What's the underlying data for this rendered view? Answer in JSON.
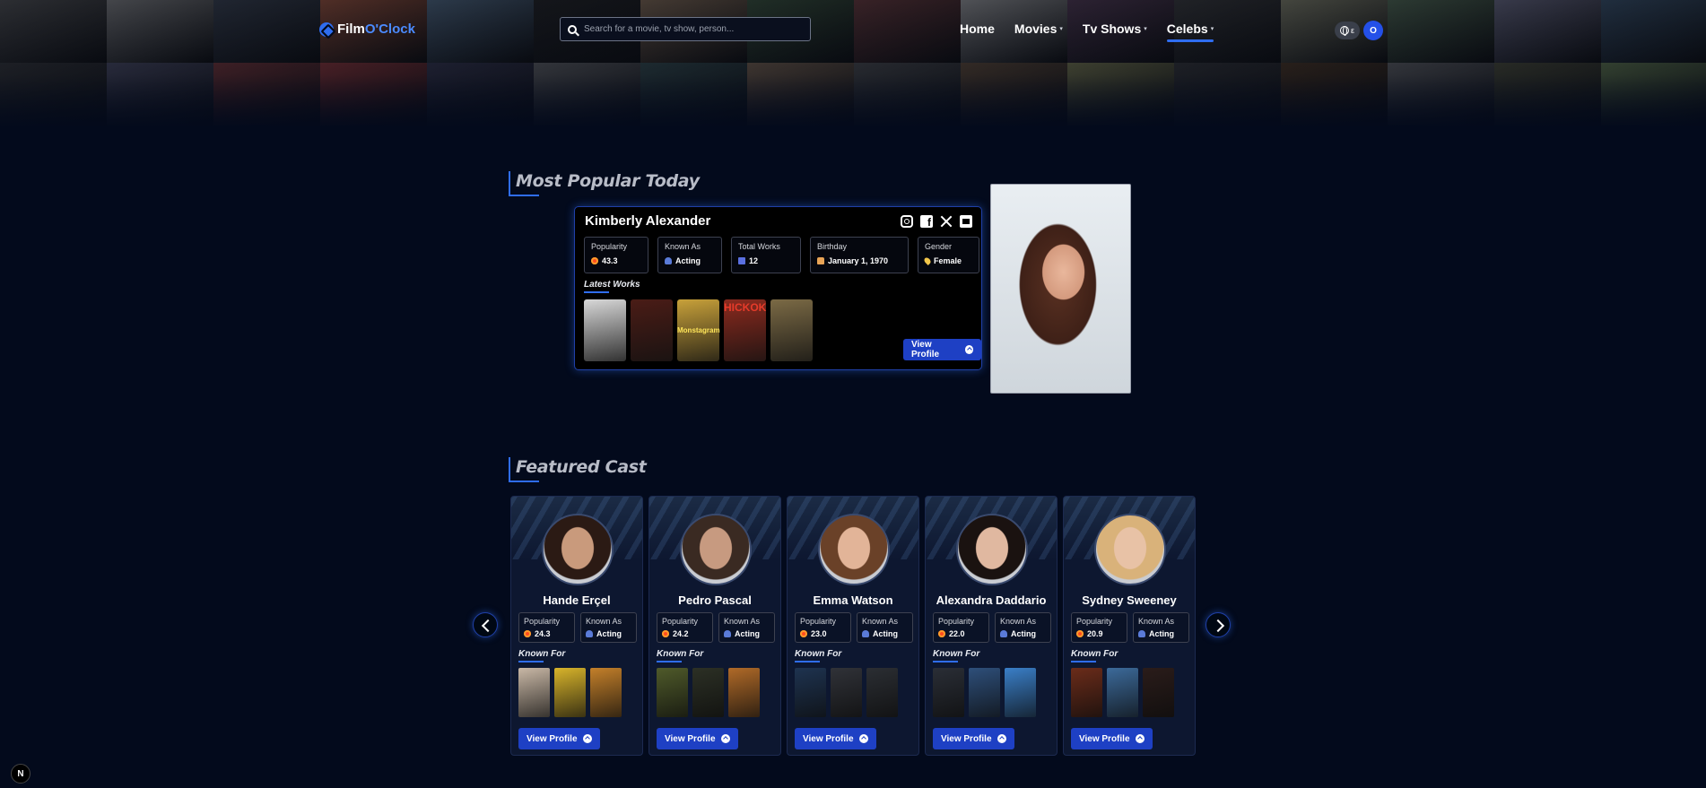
{
  "header": {
    "logo_part1": "Film",
    "logo_part2": "O'Clock",
    "search_placeholder": "Search for a movie, tv show, person...",
    "nav": [
      {
        "label": "Home",
        "has_menu": false,
        "active": false
      },
      {
        "label": "Movies",
        "has_menu": true,
        "active": false
      },
      {
        "label": "Tv Shows",
        "has_menu": true,
        "active": false
      },
      {
        "label": "Celebs",
        "has_menu": true,
        "active": true
      }
    ],
    "lang_label": "ε",
    "avatar_initial": "O"
  },
  "popular": {
    "section_title": "Most Popular Today",
    "name": "Kimberly Alexander",
    "stats": [
      {
        "key": "Popularity",
        "value": "43.3",
        "icon": "fire-icon"
      },
      {
        "key": "Known As",
        "value": "Acting",
        "icon": "user-icon"
      },
      {
        "key": "Total Works",
        "value": "12",
        "icon": "film-icon"
      },
      {
        "key": "Birthday",
        "value": "January 1, 1970",
        "icon": "cake-icon"
      },
      {
        "key": "Gender",
        "value": "Female",
        "icon": "pin-icon"
      }
    ],
    "latest_works_label": "Latest Works",
    "works": [
      {
        "color": "#d8d8d8"
      },
      {
        "color": "#4a1c16"
      },
      {
        "color": "#c8a13a",
        "text": "Monstagram"
      },
      {
        "color": "#8c2a1e",
        "text": "HICKOK"
      },
      {
        "color": "#7b6a45"
      }
    ],
    "view_profile_label": "View Profile"
  },
  "featured": {
    "section_title": "Featured Cast",
    "known_for_label": "Known For",
    "view_profile_label": "View Profile",
    "popularity_label": "Popularity",
    "known_as_label": "Known As",
    "cast": [
      {
        "name": "Hande Erçel",
        "popularity": "24.3",
        "known_as": "Acting",
        "films": [
          "#c9b8a6",
          "#d8b42b",
          "#c4802a"
        ],
        "skin": "#c99a7c",
        "hair": "#2b1a14"
      },
      {
        "name": "Pedro Pascal",
        "popularity": "24.2",
        "known_as": "Acting",
        "films": [
          "#4f5a2a",
          "#2c3025",
          "#b06a28"
        ],
        "skin": "#c79a80",
        "hair": "#3a2a22"
      },
      {
        "name": "Emma Watson",
        "popularity": "23.0",
        "known_as": "Acting",
        "films": [
          "#1e3350",
          "#303238",
          "#2b2e33"
        ],
        "skin": "#e2b498",
        "hair": "#6a4128"
      },
      {
        "name": "Alexandra Daddario",
        "popularity": "22.0",
        "known_as": "Acting",
        "films": [
          "#2a2e36",
          "#2e4f7a",
          "#3a7fc8"
        ],
        "skin": "#e0b8a0",
        "hair": "#1a1210"
      },
      {
        "name": "Sydney Sweeney",
        "popularity": "20.9",
        "known_as": "Acting",
        "films": [
          "#6b2c1a",
          "#3c6a9a",
          "#2a1c1a"
        ],
        "skin": "#e8c2a6",
        "hair": "#d9b27a"
      }
    ]
  },
  "poster_colors_row1": [
    "#3a3a3a",
    "#5a5a5a",
    "#2a2f38",
    "#6a3a2a",
    "#3a4a5a",
    "#1a1a1a",
    "#5a4a3a",
    "#2a3a2a",
    "#4a2a2a",
    "#6a6a6a",
    "#3a2a3a",
    "#2a2a2a",
    "#5a5a4a",
    "#3a4a3a",
    "#4a4a5a",
    "#2a3a4a"
  ],
  "poster_colors_row2": [
    "#2a2a2a",
    "#3a3a4a",
    "#5a2a2a",
    "#6a2a2a",
    "#2a2a3a",
    "#4a4a4a",
    "#2a3a3a",
    "#5a4a3a",
    "#3a3a3a",
    "#4a3a2a",
    "#5a5a3a",
    "#2a2a2a",
    "#3a2a1a",
    "#4a4a4a",
    "#3a3a2a",
    "#4a5a3a"
  ],
  "next_badge": "N"
}
